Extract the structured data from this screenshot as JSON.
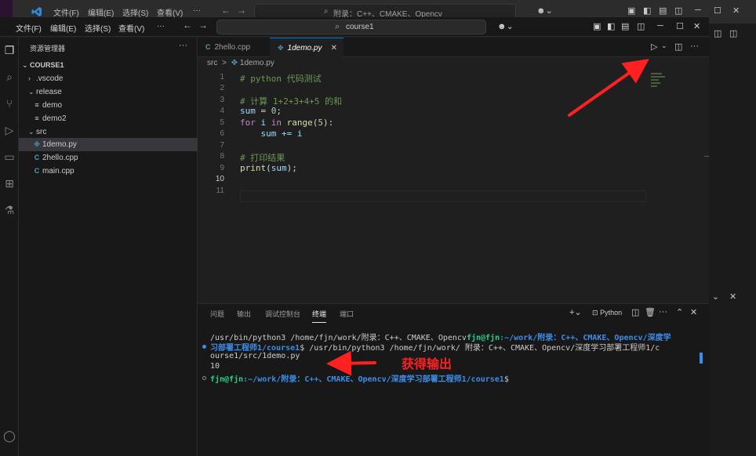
{
  "background_window": {
    "menu": [
      "文件(F)",
      "编辑(E)",
      "选择(S)",
      "查看(V)",
      "···"
    ],
    "search_text": "附录：C++、CMAKE、Opencv"
  },
  "window": {
    "menu": [
      "文件(F)",
      "编辑(E)",
      "选择(S)",
      "查看(V)",
      "···"
    ],
    "search_text": "course1"
  },
  "sidebar": {
    "title": "资源管理器",
    "more": "···",
    "tree": [
      {
        "label": "COURSE1",
        "icon": "chevron-down-icon"
      },
      {
        "label": ".vscode",
        "icon": "chevron-right-icon"
      },
      {
        "label": "release",
        "icon": "chevron-down-icon"
      },
      {
        "label": "demo",
        "icon": "file-icon"
      },
      {
        "label": "demo2",
        "icon": "file-icon"
      },
      {
        "label": "src",
        "icon": "chevron-down-icon"
      },
      {
        "label": "1demo.py",
        "icon": "python-icon"
      },
      {
        "label": "2hello.cpp",
        "icon": "cpp-icon"
      },
      {
        "label": "main.cpp",
        "icon": "cpp-icon"
      }
    ]
  },
  "tabs": [
    {
      "label": "2hello.cpp",
      "icon": "C"
    },
    {
      "label": "1demo.py",
      "icon": "✥",
      "close": "✕"
    }
  ],
  "breadcrumb": {
    "folder": "src",
    "sep": ">",
    "file": "1demo.py"
  },
  "editor": {
    "line_numbers": [
      "1",
      "2",
      "3",
      "4",
      "5",
      "6",
      "7",
      "8",
      "9",
      "10",
      "11"
    ],
    "current_line": "10",
    "lines": {
      "l1": "# python 代码测试",
      "l3": "# 计算 1+2+3+4+5 的和",
      "l4_var": "sum",
      "l4_op": " = ",
      "l4_num": "0",
      "l4_end": ";",
      "l5_kw1": "for",
      "l5_var": " i ",
      "l5_kw2": "in",
      "l5_fn": " range",
      "l5_p1": "(",
      "l5_num": "5",
      "l5_p2": "):",
      "l6": "    sum += i",
      "l8": "# 打印结果",
      "l9_fn": "print",
      "l9_p1": "(",
      "l9_var": "sum",
      "l9_p2": ");"
    }
  },
  "panel": {
    "tabs": [
      "问题",
      "输出",
      "调试控制台",
      "终端",
      "端口"
    ],
    "active_tab": "终端",
    "shell_label": "Python",
    "terminal": {
      "line1_a": "/usr/bin/python3 /home/fjn/work/附录：C++、CMAKE、Opencv",
      "line1_user": "fjn@fjn",
      "line1_path": ":~/work/附录：C++、CMAKE、Opencv/深度学",
      "line2_path": "习部署工程师1/course1",
      "line2_cmd": "$ /usr/bin/python3 /home/fjn/work/ 附录：C++、CMAKE、Opencv/深度学习部署工程师1/c",
      "line3": "ourse1/src/1demo.py",
      "line4": "10",
      "line5_user": "fjn@fjn",
      "line5_path": ":~/work/附录：C++、CMAKE、Opencv/深度学习部署工程师1/course1",
      "line5_end": "$"
    }
  },
  "annotation": {
    "label": "获得输出",
    "color": "#ff2020"
  },
  "colors": {
    "accent": "#0078d4",
    "terminal_user": "#23d18b",
    "terminal_path": "#3b8eea"
  }
}
